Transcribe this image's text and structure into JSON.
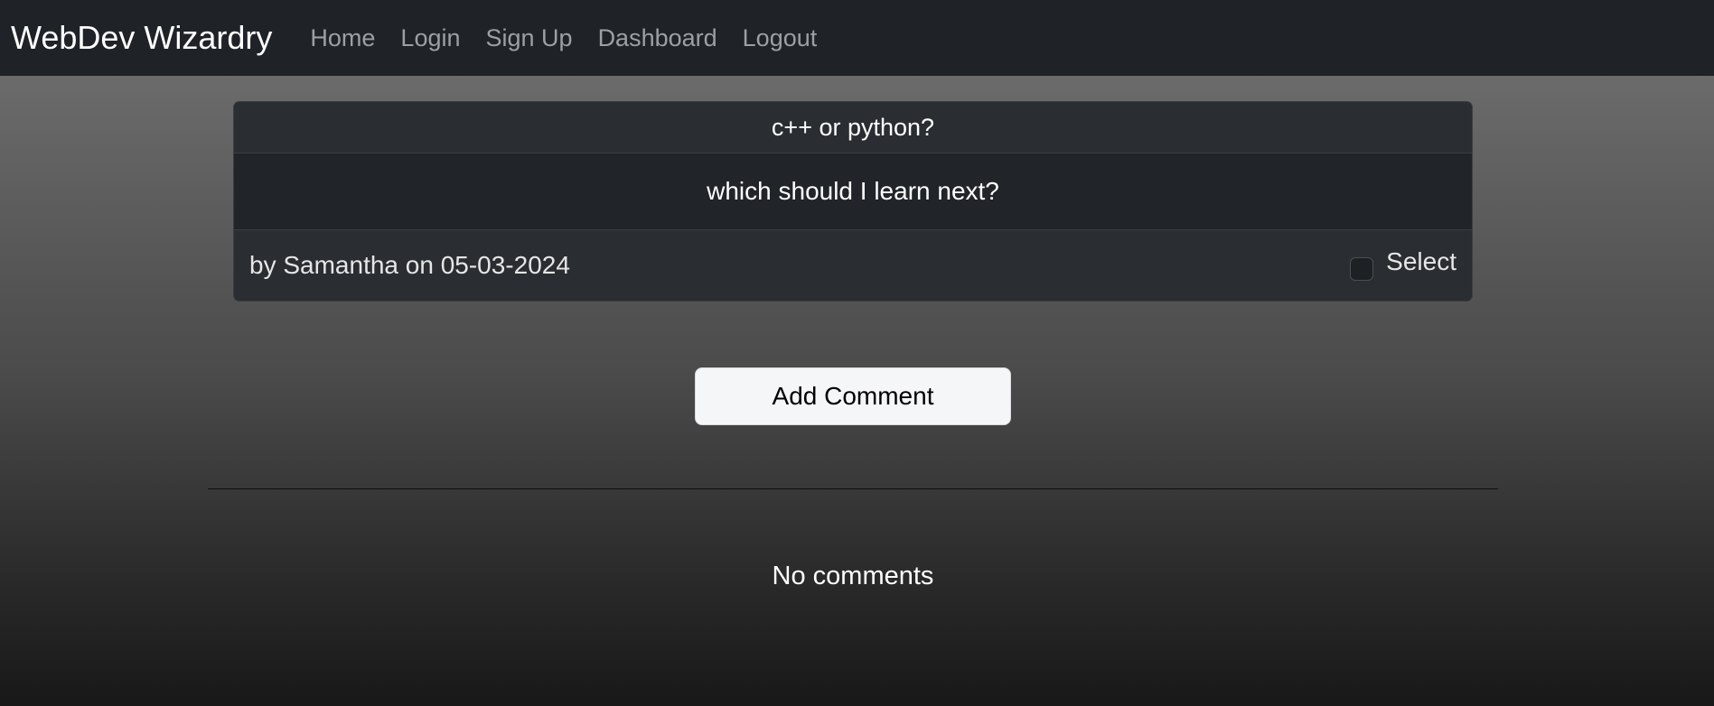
{
  "navbar": {
    "brand": "WebDev Wizardry",
    "links": [
      {
        "label": "Home"
      },
      {
        "label": "Login"
      },
      {
        "label": "Sign Up"
      },
      {
        "label": "Dashboard"
      },
      {
        "label": "Logout"
      }
    ]
  },
  "post": {
    "title": "c++ or python?",
    "body": "which should I learn next?",
    "meta": "by Samantha on 05-03-2024",
    "select_label": "Select",
    "selected": false
  },
  "actions": {
    "add_comment_label": "Add Comment"
  },
  "comments": {
    "empty_text": "No comments"
  },
  "colors": {
    "navbar_bg": "#1f2226",
    "card_bg": "#212428",
    "button_bg": "#f5f6f8"
  }
}
